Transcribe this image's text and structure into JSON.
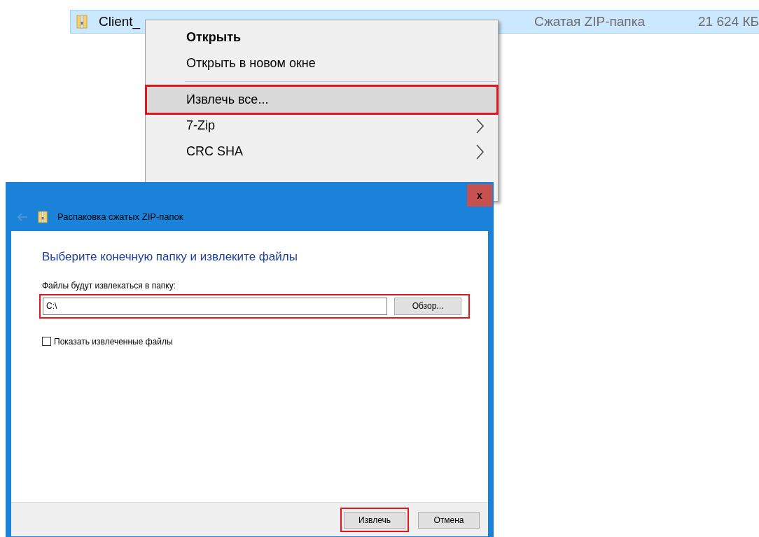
{
  "file_row": {
    "name": "Client_",
    "type": "Сжатая ZIP-папка",
    "size": "21 624 КБ",
    "selected": true
  },
  "context_menu": {
    "items": [
      {
        "label": "Открыть",
        "bold": true,
        "selected": false,
        "highlighted": false,
        "submenu": false
      },
      {
        "label": "Открыть в новом окне",
        "bold": false,
        "selected": false,
        "highlighted": false,
        "submenu": false,
        "separator_after": true
      },
      {
        "label": "Извлечь все...",
        "bold": false,
        "selected": true,
        "highlighted": true,
        "submenu": false
      },
      {
        "label": "7-Zip",
        "bold": false,
        "selected": false,
        "highlighted": false,
        "submenu": true
      },
      {
        "label": "CRC SHA",
        "bold": false,
        "selected": false,
        "highlighted": false,
        "submenu": true
      }
    ]
  },
  "dialog": {
    "close": "x",
    "title": "Распаковка сжатых ZIP-папок",
    "heading": "Выберите конечную папку и извлеките файлы",
    "path_label": "Файлы будут извлекаться в папку:",
    "path_value": "C:\\",
    "browse": "Обзор...",
    "path_highlighted": true,
    "show_files": {
      "label": "Показать извлеченные файлы",
      "checked": false
    },
    "buttons": [
      {
        "label": "Извлечь",
        "highlighted": true
      },
      {
        "label": "Отмена",
        "highlighted": false
      }
    ]
  }
}
